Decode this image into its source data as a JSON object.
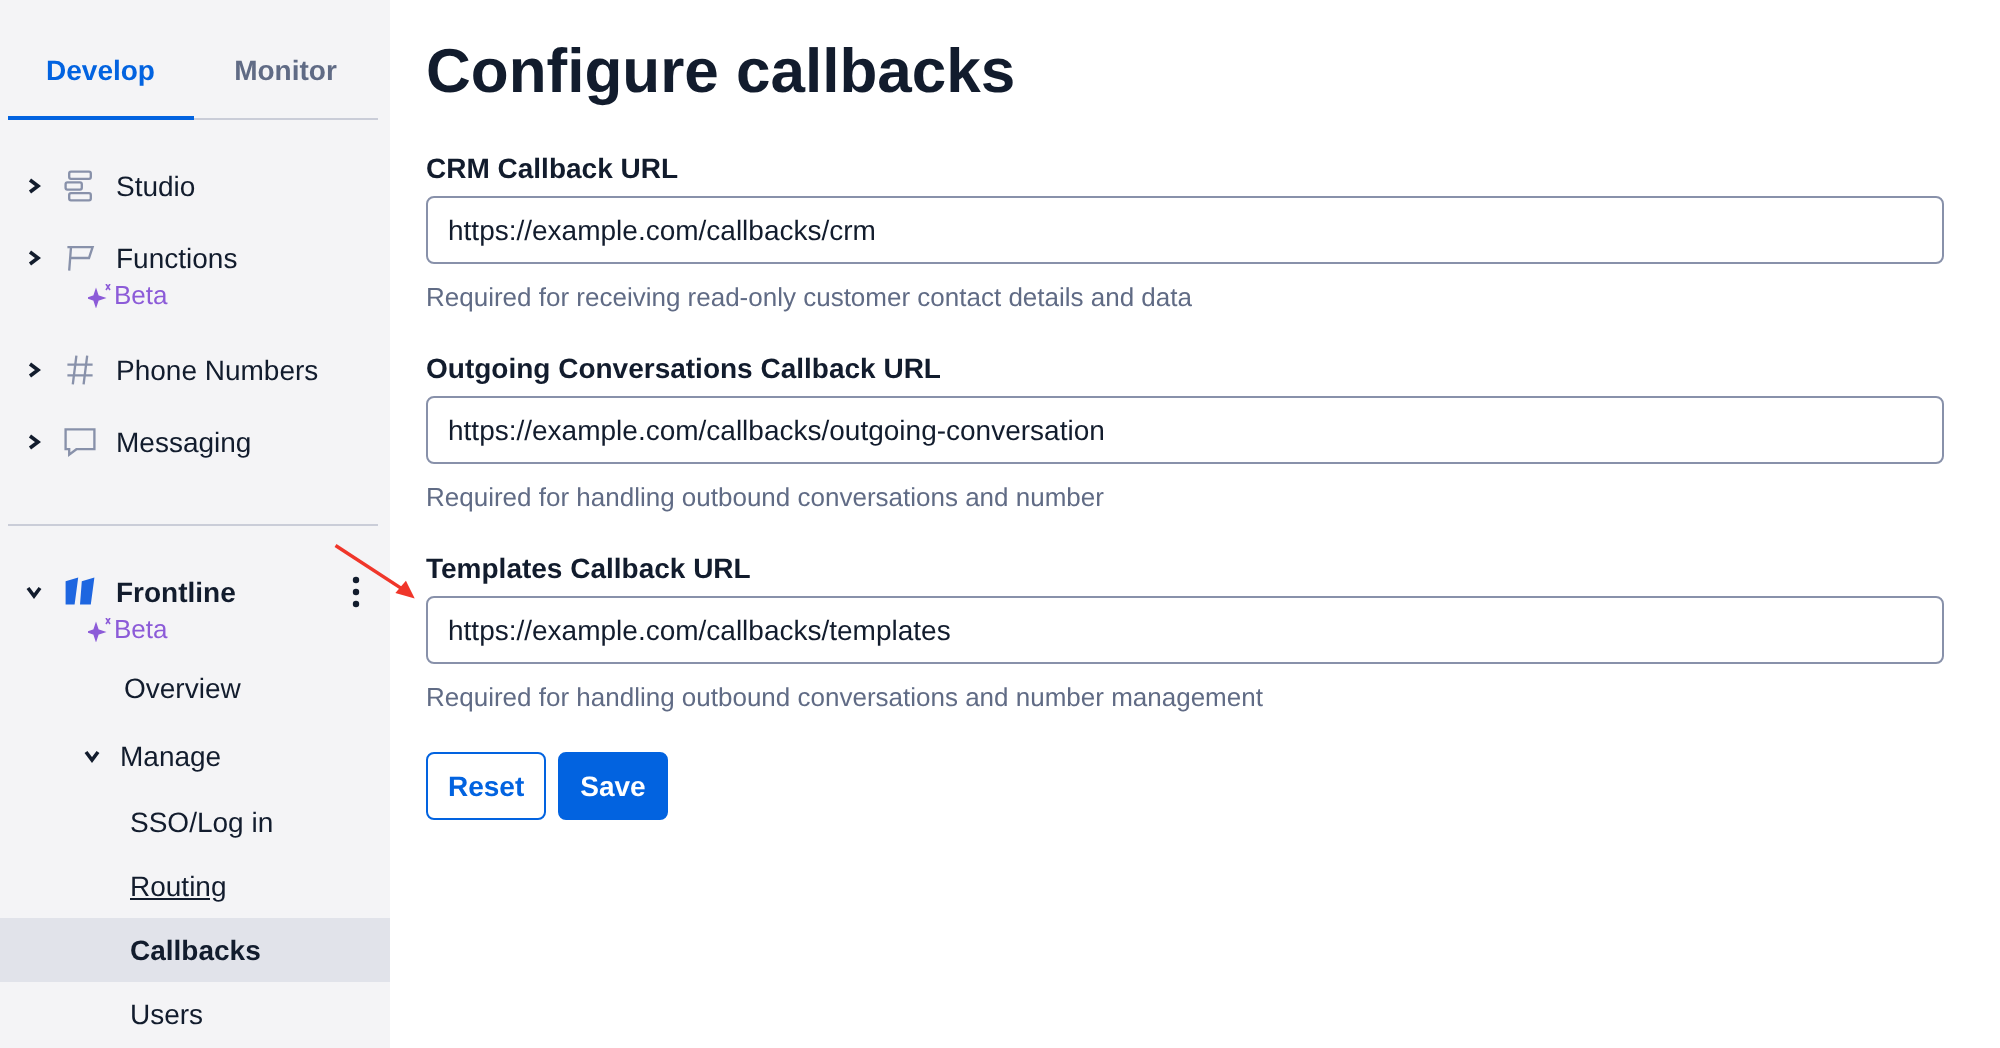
{
  "sidebar": {
    "tabs": [
      {
        "label": "Develop",
        "selected": true
      },
      {
        "label": "Monitor",
        "selected": false
      }
    ],
    "products": [
      {
        "label": "Studio",
        "expanded": false
      },
      {
        "label": "Functions",
        "expanded": false,
        "badge": "Beta"
      },
      {
        "label": "Phone Numbers",
        "expanded": false
      },
      {
        "label": "Messaging",
        "expanded": false
      }
    ],
    "app": {
      "label": "Frontline",
      "badge": "Beta",
      "expanded": true,
      "children": [
        {
          "label": "Overview",
          "selected": false
        },
        {
          "label": "Manage",
          "expanded": true,
          "children": [
            {
              "label": "SSO/Log in",
              "selected": false,
              "underlined": false
            },
            {
              "label": "Routing",
              "selected": false,
              "underlined": true
            },
            {
              "label": "Callbacks",
              "selected": true,
              "underlined": false
            },
            {
              "label": "Users",
              "selected": false,
              "underlined": false
            }
          ]
        }
      ]
    }
  },
  "main": {
    "title": "Configure callbacks",
    "fields": [
      {
        "label": "CRM Callback URL",
        "value": "https://example.com/callbacks/crm",
        "help": "Required for receiving read-only customer contact details and data"
      },
      {
        "label": "Outgoing Conversations Callback URL",
        "value": "https://example.com/callbacks/outgoing-conversation",
        "help": "Required for handling outbound conversations and number"
      },
      {
        "label": "Templates Callback URL",
        "value": "https://example.com/callbacks/templates",
        "help": "Required for handling outbound conversations and number management"
      }
    ],
    "buttons": [
      {
        "label": "Reset",
        "kind": "secondary"
      },
      {
        "label": "Save",
        "kind": "primary"
      }
    ]
  }
}
